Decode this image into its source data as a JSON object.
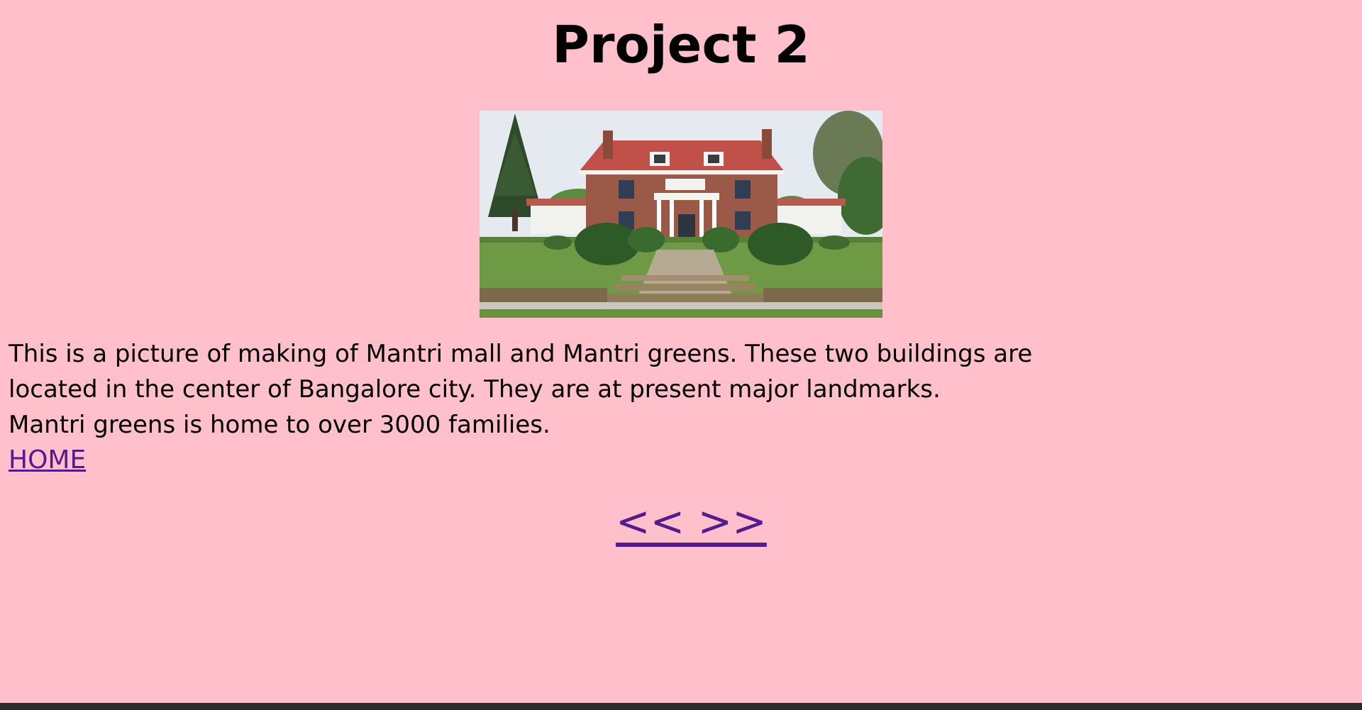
{
  "page": {
    "title": "Project 2",
    "background_color": "#ffbfcb",
    "link_color": "#551a8b"
  },
  "photo": {
    "subject": "house-photo"
  },
  "description": {
    "line1": "This is a picture of making of Mantri mall and Mantri greens. These two buildings are",
    "line2": "located in the center of Bangalore city. They are at present major landmarks.",
    "line3": "Mantri greens is home to over 3000 families."
  },
  "links": {
    "home": "HOME",
    "pager": "<< >>"
  }
}
